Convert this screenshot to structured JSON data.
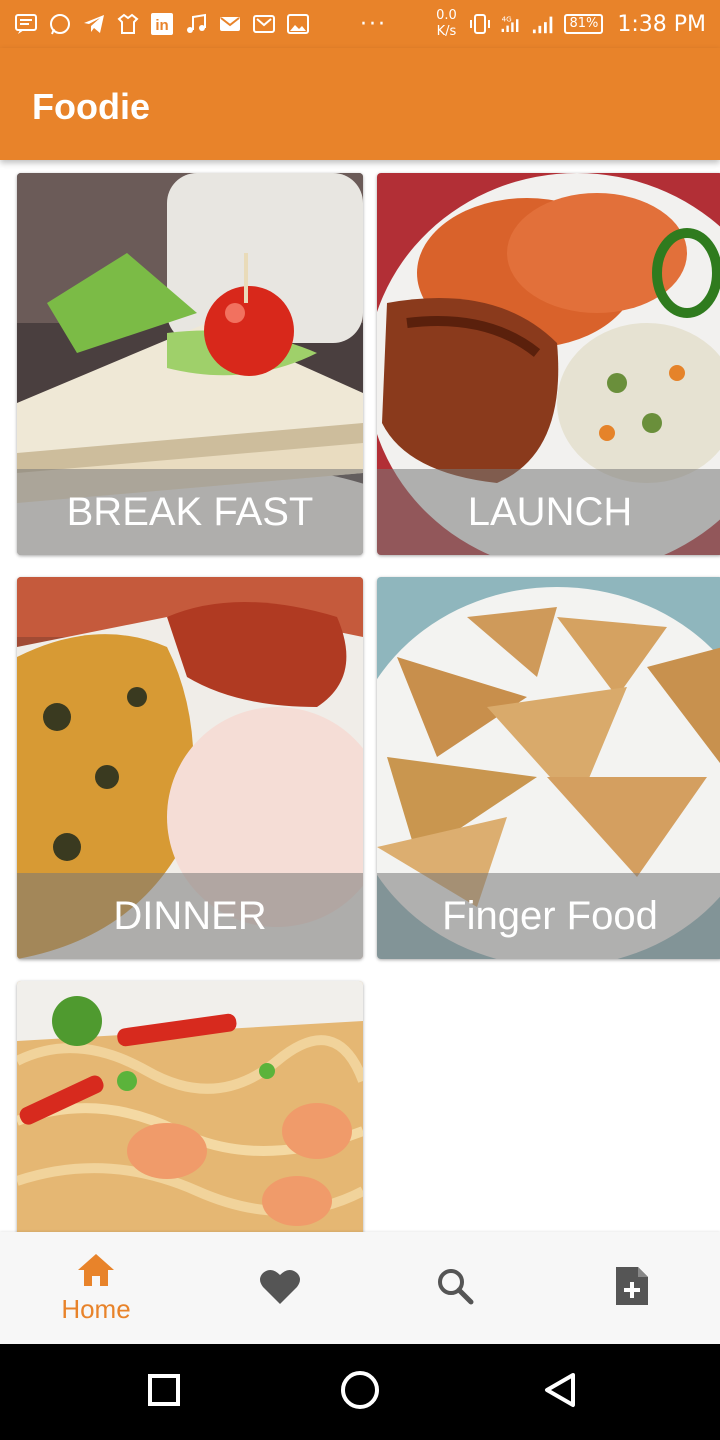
{
  "status_bar": {
    "net_speed_value": "0.0",
    "net_speed_unit": "K/s",
    "network_type": "4G",
    "battery": "81%",
    "time": "1:38 PM",
    "overflow": "···"
  },
  "app_bar": {
    "title": "Foodie"
  },
  "categories": [
    {
      "label": "BREAK FAST"
    },
    {
      "label": "LAUNCH"
    },
    {
      "label": "DINNER"
    },
    {
      "label": "Finger Food"
    },
    {
      "label": ""
    }
  ],
  "bottom_nav": {
    "active": "home",
    "items": [
      {
        "id": "home",
        "label": "Home",
        "icon": "home-icon"
      },
      {
        "id": "favorites",
        "label": "",
        "icon": "heart-icon"
      },
      {
        "id": "search",
        "label": "",
        "icon": "search-icon"
      },
      {
        "id": "add",
        "label": "",
        "icon": "add-document-icon"
      }
    ]
  },
  "colors": {
    "accent": "#e8832a",
    "inactive_icon": "#555555",
    "nav_bg": "#f7f7f7"
  }
}
